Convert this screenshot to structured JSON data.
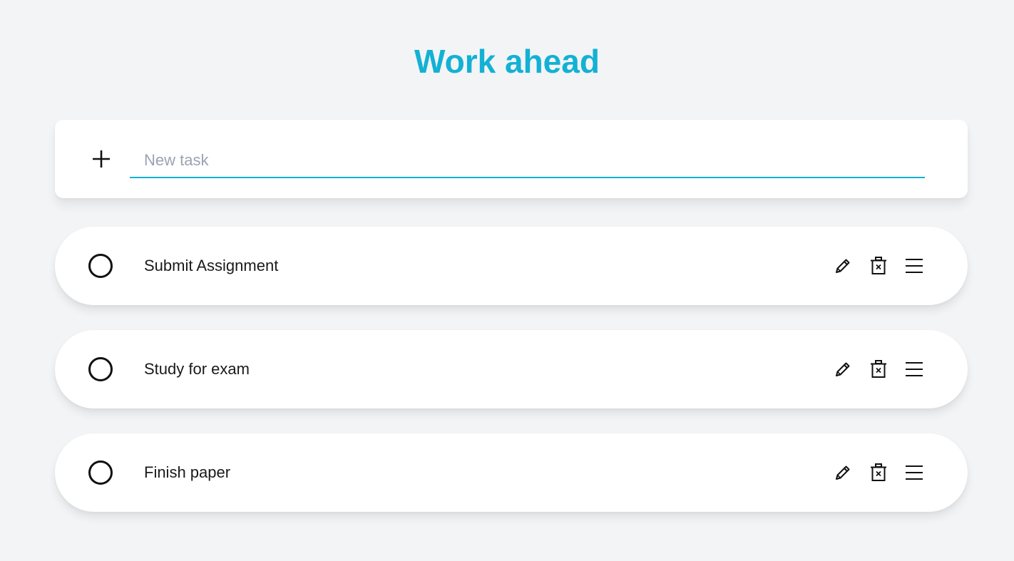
{
  "header": {
    "title": "Work ahead"
  },
  "new_task": {
    "placeholder": "New task",
    "value": "",
    "add_icon": "plus-icon"
  },
  "tasks": [
    {
      "label": "Submit Assignment",
      "completed": false
    },
    {
      "label": "Study for exam",
      "completed": false
    },
    {
      "label": "Finish paper",
      "completed": false
    }
  ],
  "task_actions": {
    "edit_icon": "pencil-icon",
    "delete_icon": "trash-icon",
    "reorder_icon": "drag-handle-icon"
  },
  "colors": {
    "accent": "#13b1d4",
    "background": "#f3f4f6",
    "card": "#ffffff",
    "placeholder": "#9ca3af",
    "text": "#1a1a1a"
  }
}
